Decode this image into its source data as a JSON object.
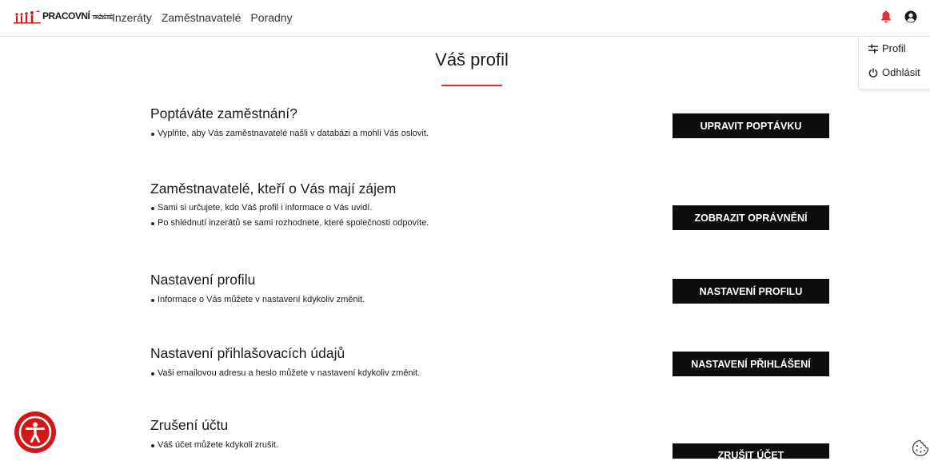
{
  "header": {
    "logo_text": "PRACOVNÍ",
    "logo_small": "TRŽIŠTĚ",
    "nav": [
      "Inzeráty",
      "Zaměstnavatelé",
      "Poradny"
    ]
  },
  "user_menu": {
    "items": [
      {
        "label": "Profil",
        "icon": "sliders-icon"
      },
      {
        "label": "Odhlásit",
        "icon": "power-icon"
      }
    ]
  },
  "page": {
    "title": "Váš profil"
  },
  "sections": [
    {
      "heading": "Poptáváte zaměstnání?",
      "bullets": [
        "Vyplňte, aby Vás zaměstnavatelé našli v databázi a mohli Vás oslovit."
      ],
      "button": "UPRAVIT POPTÁVKU"
    },
    {
      "heading": "Zaměstnavatelé, kteří o Vás mají zájem",
      "bullets": [
        "Sami si určujete, kdo Váš profil i informace o Vás uvidí.",
        "Po shlédnutí inzerátů se sami rozhodnete, které společnosti odpovíte."
      ],
      "button": "ZOBRAZIT OPRÁVNĚNÍ"
    },
    {
      "heading": "Nastavení profilu",
      "bullets": [
        "Informace o Vás můžete v nastavení kdykoliv změnit."
      ],
      "button": "NASTAVENÍ PROFILU"
    },
    {
      "heading": "Nastavení přihlašovacích údajů",
      "bullets": [
        "Vaši emailovou adresu a heslo můžete v nastavení kdykoliv změnit."
      ],
      "button": "NASTAVENÍ PŘIHLÁŠENÍ"
    },
    {
      "heading": "Zrušení účtu",
      "bullets": [
        "Váš účet můžete kdykoli zrušit."
      ],
      "button": "ZRUŠIT ÚČET"
    }
  ],
  "colors": {
    "accent": "#e03131",
    "button_bg": "#0d0d0d",
    "accessibility_bg": "#d01818"
  }
}
